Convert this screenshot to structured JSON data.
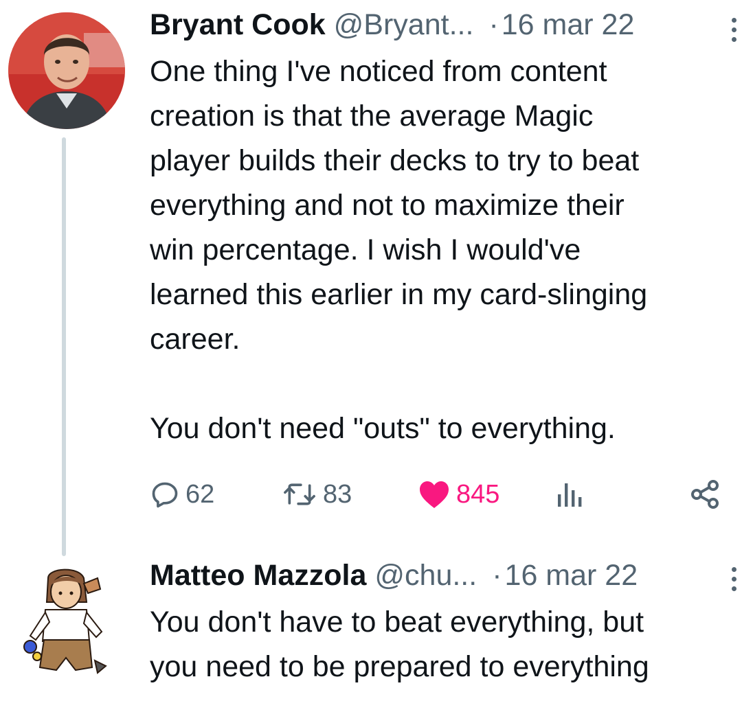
{
  "tweet1": {
    "name": "Bryant Cook",
    "handle": "@Bryant...",
    "separator": "·",
    "date": "16 mar 22",
    "text": "One thing I've noticed from content\ncreation is that the average Magic\nplayer builds their decks to try to beat\neverything and not to maximize their\nwin percentage. I wish I would've\nlearned this earlier in my card-slinging\ncareer.\n\nYou don't need \"outs\" to everything.",
    "reply_count": "62",
    "retweet_count": "83",
    "like_count": "845",
    "liked": true
  },
  "tweet2": {
    "name": "Matteo Mazzola",
    "handle": "@chu...",
    "separator": "·",
    "date": "16 mar 22",
    "text": "You don't have to beat everything, but\nyou need to be prepared to everything"
  },
  "colors": {
    "like_active": "#f91880",
    "secondary_text": "#536471",
    "thread_line": "#cfd9de"
  },
  "icons": [
    "reply-icon",
    "retweet-icon",
    "heart-icon",
    "views-icon",
    "share-icon",
    "more-icon"
  ]
}
